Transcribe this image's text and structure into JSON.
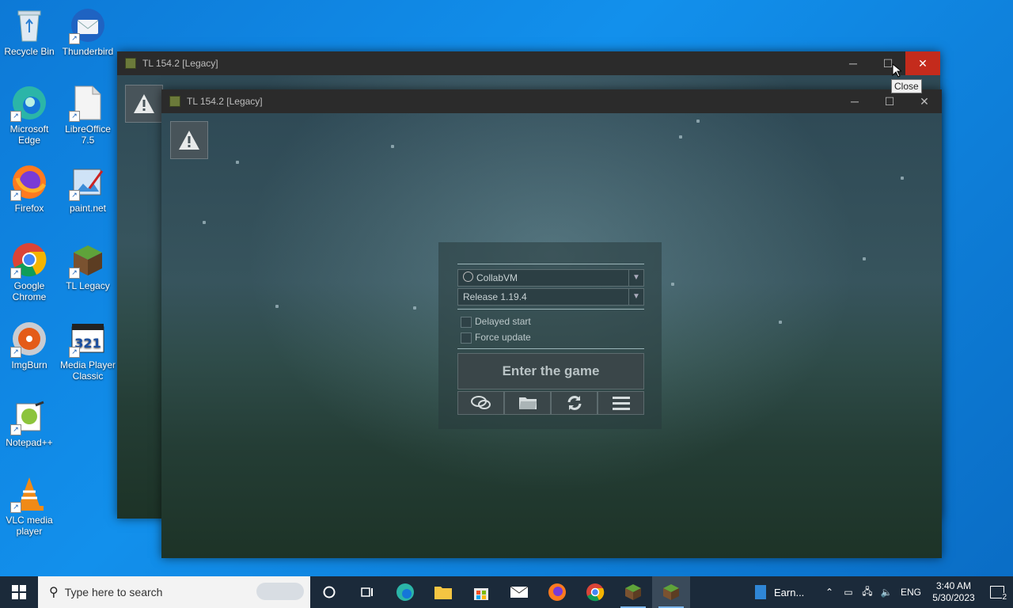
{
  "desktop": {
    "icons": [
      {
        "label": "Recycle Bin"
      },
      {
        "label": "Thunderbird"
      },
      {
        "label": "Microsoft Edge"
      },
      {
        "label": "LibreOffice 7.5"
      },
      {
        "label": "Firefox"
      },
      {
        "label": "paint.net"
      },
      {
        "label": "Google Chrome"
      },
      {
        "label": "TL Legacy"
      },
      {
        "label": "ImgBurn"
      },
      {
        "label": "Media Player Classic"
      },
      {
        "label": "Notepad++"
      },
      {
        "label": "VLC media player"
      }
    ]
  },
  "back_window": {
    "title": "TL 154.2 [Legacy]",
    "minimize": "─",
    "maximize": "☐",
    "close": "✕"
  },
  "front_window": {
    "title": "TL 154.2 [Legacy]",
    "minimize": "─",
    "maximize": "☐",
    "close": "✕"
  },
  "tooltip": "Close",
  "launcher": {
    "account": "CollabVM",
    "version": "Release 1.19.4",
    "delayed_start": "Delayed start",
    "force_update": "Force update",
    "enter_button": "Enter the game",
    "icons": [
      "chat-icon",
      "folder-icon",
      "refresh-icon",
      "menu-icon"
    ]
  },
  "taskbar": {
    "search_placeholder": "Type here to search",
    "pinned": [
      "cortana-icon",
      "task-view-icon",
      "edge-icon",
      "file-explorer-icon",
      "store-icon",
      "mail-icon",
      "firefox-icon",
      "chrome-icon",
      "tl-legacy-icon",
      "tl-legacy-icon"
    ],
    "running_app": "Earn...",
    "language": "ENG",
    "time": "3:40 AM",
    "date": "5/30/2023",
    "notifications": "2"
  },
  "colors": {
    "desktop": "#0d79d6",
    "close_hover": "#c42b1c",
    "taskbar": "#1b2a3a"
  }
}
